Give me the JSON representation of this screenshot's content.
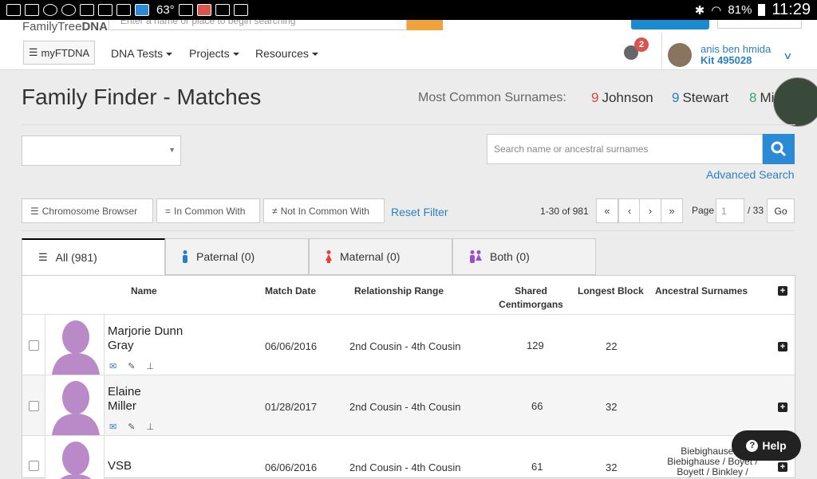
{
  "statusbar": {
    "temperature": "63°",
    "battery": "81%",
    "time": "11:29"
  },
  "header": {
    "logo_prefix": "FamilyTree",
    "logo_suffix": "DNA",
    "search_placeholder": "Enter a name or place to begin searching",
    "nav": {
      "myftdna": "myFTDNA",
      "dna_tests": "DNA Tests",
      "projects": "Projects",
      "resources": "Resources"
    },
    "notifications_count": "2",
    "user": {
      "name": "anis ben hmida",
      "kit": "Kit 495028"
    }
  },
  "page": {
    "title": "Family Finder - Matches",
    "surnames_label": "Most Common Surnames:",
    "surnames": [
      {
        "count": "9",
        "name": "Johnson",
        "color": "#e2403b"
      },
      {
        "count": "9",
        "name": "Stewart",
        "color": "#2a7fc4"
      },
      {
        "count": "8",
        "name": "Mi",
        "color": "#3aa66b"
      }
    ]
  },
  "search": {
    "placeholder": "Search name or ancestral surnames",
    "advanced_label": "Advanced Search"
  },
  "filters": {
    "chromosome_browser": "Chromosome Browser",
    "in_common_with": "In Common With",
    "not_in_common_with": "Not In Common With",
    "reset": "Reset Filter"
  },
  "pagination": {
    "range": "1-30 of 981",
    "first": "«",
    "prev": "‹",
    "next": "›",
    "last": "»",
    "page_label": "Page",
    "page_value": "1",
    "total": "/ 33",
    "go": "Go"
  },
  "tabs": [
    {
      "label": "All (981)",
      "icon": "list-icon",
      "color": "#333"
    },
    {
      "label": "Paternal (0)",
      "icon": "male-icon",
      "color": "#2a7fc4"
    },
    {
      "label": "Maternal (0)",
      "icon": "female-icon",
      "color": "#e2403b"
    },
    {
      "label": "Both (0)",
      "icon": "couple-icon",
      "color": "#9b4fc6"
    }
  ],
  "table": {
    "headers": {
      "name": "Name",
      "match_date": "Match Date",
      "relationship": "Relationship Range",
      "shared_cm_1": "Shared",
      "shared_cm_2": "Centimorgans",
      "longest_block": "Longest Block",
      "ancestral": "Ancestral Surnames",
      "expand": "+"
    },
    "rows": [
      {
        "name_1": "Marjorie Dunn",
        "name_2": "Gray",
        "date": "06/06/2016",
        "relationship": "2nd Cousin - 4th Cousin",
        "shared": "129",
        "longest": "22",
        "ancestral_1": "",
        "ancestral_2": "",
        "ancestral_3": ""
      },
      {
        "name_1": "Elaine",
        "name_2": "Miller",
        "date": "01/28/2017",
        "relationship": "2nd Cousin - 4th Cousin",
        "shared": "66",
        "longest": "32",
        "ancestral_1": "",
        "ancestral_2": "",
        "ancestral_3": ""
      },
      {
        "name_1": "VSB",
        "name_2": "",
        "date": "06/06/2016",
        "relationship": "2nd Cousin - 4th Cousin",
        "shared": "61",
        "longest": "32",
        "ancestral_1": "Biebighausen /",
        "ancestral_2": "Biebighause / Boyet /",
        "ancestral_3": "Boyett / Binkley /"
      }
    ]
  },
  "help": {
    "label": "Help"
  }
}
